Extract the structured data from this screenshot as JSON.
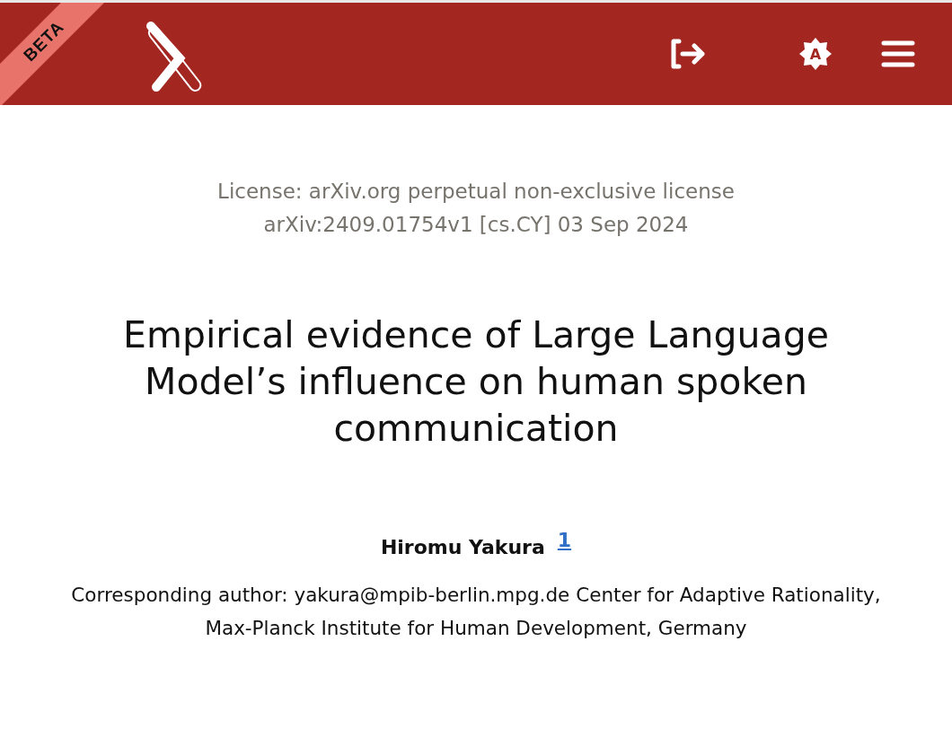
{
  "header": {
    "ribbon": "BETA",
    "theme_button_letter": "A"
  },
  "license": "License: arXiv.org perpetual non-exclusive license",
  "identifier": "arXiv:2409.01754v1 [cs.CY] 03 Sep 2024",
  "title": "Empirical evidence of Large Language Model’s influence on human spoken communication",
  "author": {
    "name": "Hiromu Yakura",
    "affiliation_mark": "1"
  },
  "note": "Corresponding author: yakura@mpib-berlin.mpg.de Center for Adaptive Rationality, Max-Planck Institute for Human Development, Germany"
}
